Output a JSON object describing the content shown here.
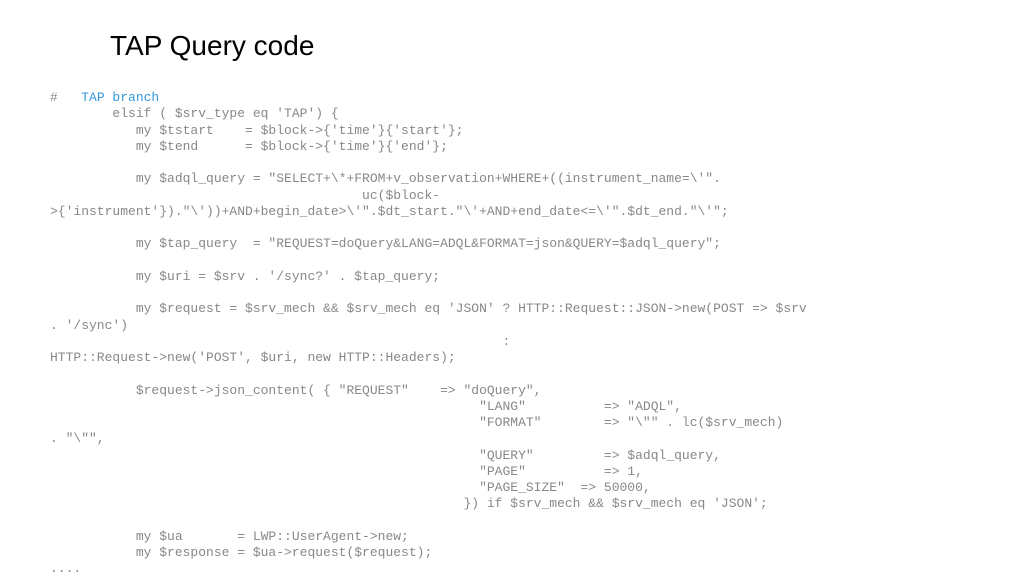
{
  "title": "TAP Query code",
  "code": {
    "hash": "#   ",
    "comment": "TAP branch",
    "body": "\n        elsif ( $srv_type eq 'TAP') {\n           my $tstart    = $block->{'time'}{'start'};\n           my $tend      = $block->{'time'}{'end'};\n\n           my $adql_query = \"SELECT+\\*+FROM+v_observation+WHERE+((instrument_name=\\'\".\n                                        uc($block-\n>{'instrument'}).\"\\'))+AND+begin_date>\\'\".$dt_start.\"\\'+AND+end_date<=\\'\".$dt_end.\"\\'\";\n\n           my $tap_query  = \"REQUEST=doQuery&LANG=ADQL&FORMAT=json&QUERY=$adql_query\";\n\n           my $uri = $srv . '/sync?' . $tap_query;\n\n           my $request = $srv_mech && $srv_mech eq 'JSON' ? HTTP::Request::JSON->new(POST => $srv\n. '/sync')\n                                                          :\nHTTP::Request->new('POST', $uri, new HTTP::Headers);\n\n           $request->json_content( { \"REQUEST\"    => \"doQuery\",\n                                                       \"LANG\"          => \"ADQL\",\n                                                       \"FORMAT\"        => \"\\\"\" . lc($srv_mech)\n. \"\\\"\",\n                                                       \"QUERY\"         => $adql_query,\n                                                       \"PAGE\"          => 1,\n                                                       \"PAGE_SIZE\"  => 50000,\n                                                     }) if $srv_mech && $srv_mech eq 'JSON';\n\n           my $ua       = LWP::UserAgent->new;\n           my $response = $ua->request($request);\n...."
  }
}
